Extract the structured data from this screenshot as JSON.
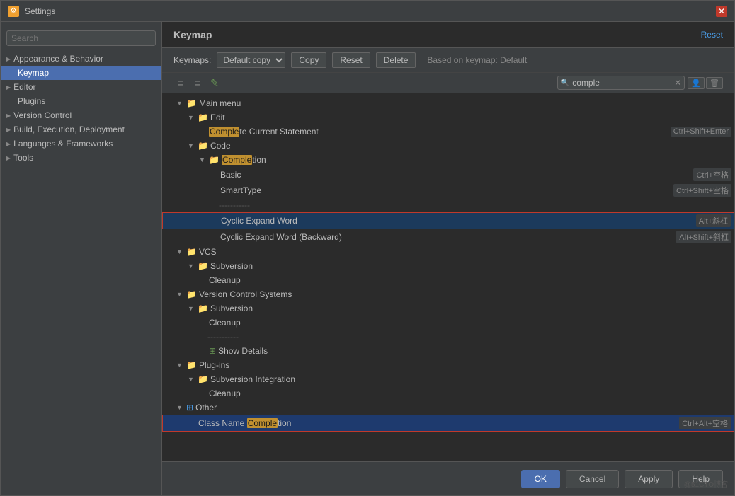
{
  "window": {
    "title": "Settings"
  },
  "sidebar": {
    "search_placeholder": "Search",
    "items": [
      {
        "id": "appearance",
        "label": "Appearance & Behavior",
        "level": 0,
        "hasArrow": true,
        "active": false
      },
      {
        "id": "keymap",
        "label": "Keymap",
        "level": 1,
        "active": true
      },
      {
        "id": "editor",
        "label": "Editor",
        "level": 0,
        "hasArrow": true,
        "active": false
      },
      {
        "id": "plugins",
        "label": "Plugins",
        "level": 1,
        "active": false
      },
      {
        "id": "version-control",
        "label": "Version Control",
        "level": 0,
        "hasArrow": true,
        "active": false
      },
      {
        "id": "build",
        "label": "Build, Execution, Deployment",
        "level": 0,
        "hasArrow": true,
        "active": false
      },
      {
        "id": "languages",
        "label": "Languages & Frameworks",
        "level": 0,
        "hasArrow": true,
        "active": false
      },
      {
        "id": "tools",
        "label": "Tools",
        "level": 0,
        "hasArrow": true,
        "active": false
      }
    ]
  },
  "panel": {
    "title": "Keymap",
    "reset_label": "Reset",
    "keymaps_label": "Keymaps:",
    "keymap_value": "Default copy",
    "copy_label": "Copy",
    "reset_btn_label": "Reset",
    "delete_label": "Delete",
    "based_on": "Based on keymap: Default",
    "search_placeholder": "comple",
    "search_value": "comple"
  },
  "tree": {
    "nodes": [
      {
        "id": "main-menu",
        "label": "Main menu",
        "level": 0,
        "type": "folder",
        "expanded": true
      },
      {
        "id": "edit",
        "label": "Edit",
        "level": 1,
        "type": "folder",
        "expanded": true
      },
      {
        "id": "complete-current",
        "label": "Complete Current Statement",
        "level": 2,
        "type": "item",
        "highlight": "Complete",
        "shortcut": "Ctrl+Shift+Enter"
      },
      {
        "id": "code",
        "label": "Code",
        "level": 1,
        "type": "folder",
        "expanded": true
      },
      {
        "id": "completion",
        "label": "Completion",
        "level": 2,
        "type": "folder",
        "expanded": true,
        "highlight": "Comple"
      },
      {
        "id": "basic",
        "label": "Basic",
        "level": 3,
        "type": "item",
        "shortcut": "Ctrl+空格"
      },
      {
        "id": "smarttype",
        "label": "SmartType",
        "level": 3,
        "type": "item",
        "shortcut": "Ctrl+Shift+空格"
      },
      {
        "id": "sep1",
        "label": "------------",
        "level": 3,
        "type": "separator"
      },
      {
        "id": "cyclic-expand",
        "label": "Cyclic Expand Word",
        "level": 3,
        "type": "item",
        "shortcut": "Alt+斜杠",
        "highlighted": true
      },
      {
        "id": "cyclic-expand-back",
        "label": "Cyclic Expand Word (Backward)",
        "level": 3,
        "type": "item",
        "shortcut": "Alt+Shift+斜杠"
      },
      {
        "id": "vcs",
        "label": "VCS",
        "level": 0,
        "type": "folder",
        "expanded": true
      },
      {
        "id": "subversion1",
        "label": "Subversion",
        "level": 1,
        "type": "folder",
        "expanded": true
      },
      {
        "id": "cleanup1",
        "label": "Cleanup",
        "level": 2,
        "type": "item"
      },
      {
        "id": "vcs-systems",
        "label": "Version Control Systems",
        "level": 0,
        "type": "folder",
        "expanded": true
      },
      {
        "id": "subversion2",
        "label": "Subversion",
        "level": 1,
        "type": "folder",
        "expanded": true
      },
      {
        "id": "cleanup2",
        "label": "Cleanup",
        "level": 2,
        "type": "item"
      },
      {
        "id": "sep2",
        "label": "------------",
        "level": 2,
        "type": "separator"
      },
      {
        "id": "show-details",
        "label": "Show Details",
        "level": 2,
        "type": "item-special"
      },
      {
        "id": "plugins",
        "label": "Plug-ins",
        "level": 0,
        "type": "folder",
        "expanded": true
      },
      {
        "id": "subversion-int",
        "label": "Subversion Integration",
        "level": 1,
        "type": "folder",
        "expanded": true
      },
      {
        "id": "cleanup3",
        "label": "Cleanup",
        "level": 2,
        "type": "item"
      },
      {
        "id": "other",
        "label": "Other",
        "level": 0,
        "type": "folder-special",
        "expanded": true
      },
      {
        "id": "class-name",
        "label": "Class Name Completion",
        "level": 1,
        "type": "item",
        "highlight": "Comple",
        "highlight_prefix": "Class Name ",
        "shortcut": "Ctrl+Alt+空格",
        "selected": true
      }
    ]
  },
  "buttons": {
    "ok": "OK",
    "cancel": "Cancel",
    "apply": "Apply",
    "help": "Help"
  },
  "watermark": "@51CTO博客"
}
